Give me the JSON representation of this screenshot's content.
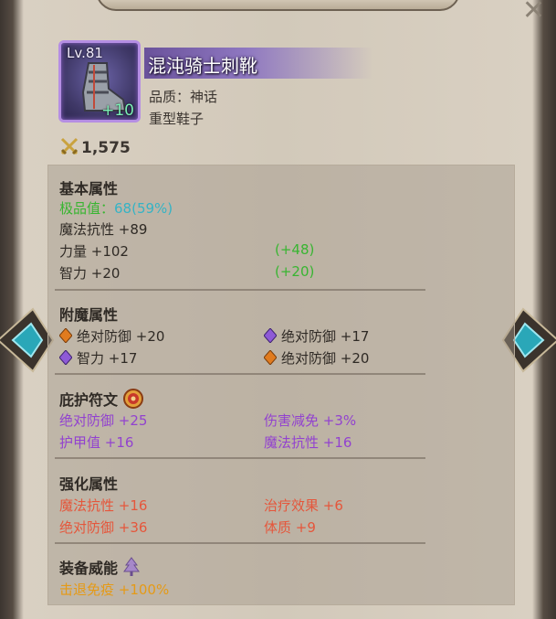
{
  "item": {
    "level": "Lv.81",
    "plus": "+10",
    "name": "混沌骑士刺靴",
    "quality": "品质：神话",
    "type": "重型鞋子",
    "power": "1,575"
  },
  "basic": {
    "title": "基本属性",
    "excellence_label": "极品值：",
    "excellence_value": "68(59%)",
    "stats": [
      {
        "label": "魔法抗性 +89",
        "bonus": ""
      },
      {
        "label": "力量 +102",
        "bonus": "(+48)"
      },
      {
        "label": "智力 +20",
        "bonus": "(+20)"
      }
    ]
  },
  "enchant": {
    "title": "附魔属性",
    "stats": [
      {
        "label": "绝对防御 +20",
        "gem": "orange-gem-icon"
      },
      {
        "label": "绝对防御 +17",
        "gem": "purple-gem-icon"
      },
      {
        "label": "智力 +17",
        "gem": "purple-gem-icon"
      },
      {
        "label": "绝对防御 +20",
        "gem": "orange-gem-icon"
      }
    ]
  },
  "rune": {
    "title": "庇护符文",
    "stats": [
      "绝对防御 +25",
      "伤害减免 +3%",
      "护甲值 +16",
      "魔法抗性 +16"
    ]
  },
  "reinforce": {
    "title": "强化属性",
    "stats": [
      "魔法抗性 +16",
      "治疗效果 +6",
      "绝对防御 +36",
      "体质 +9"
    ]
  },
  "power_ability": {
    "title": "装备威能",
    "stats": [
      "击退免疫 +100%"
    ]
  },
  "colors": {
    "enchant_orange": "#e07b1f",
    "enchant_purple": "#8e5ad6",
    "rune_text": "#9242cf",
    "reinforce_text": "#e5563b",
    "power_text": "#e59a16",
    "green_bonus": "#38b531"
  }
}
